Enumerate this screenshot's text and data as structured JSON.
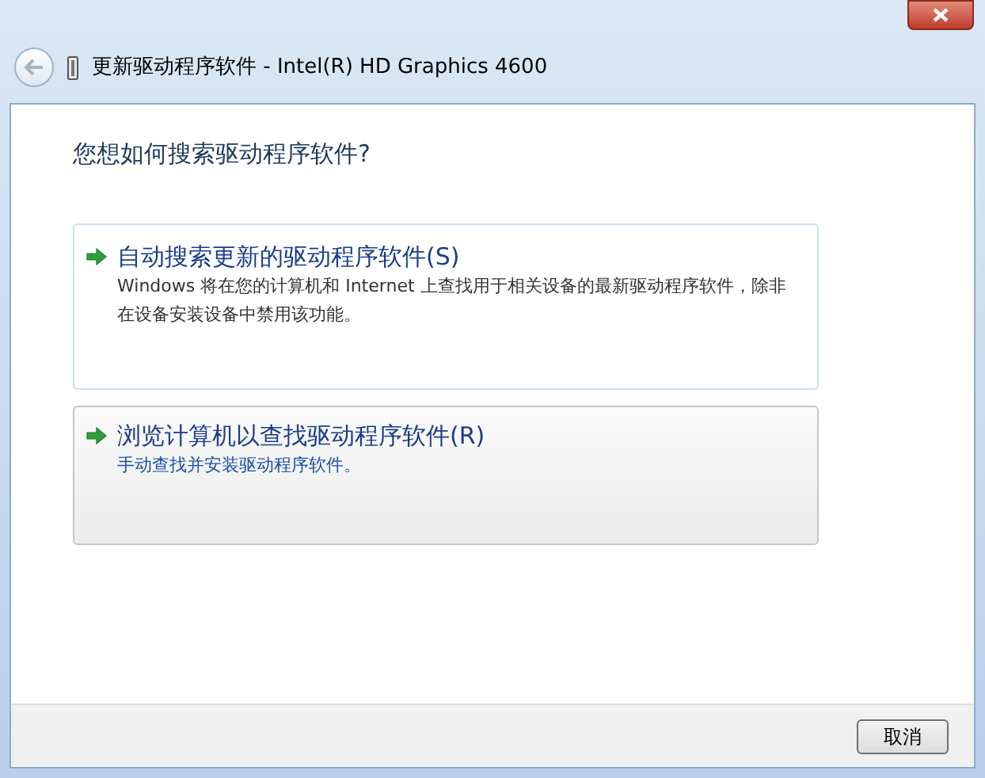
{
  "window": {
    "title": "更新驱动程序软件 - Intel(R) HD Graphics 4600"
  },
  "heading": "您想如何搜索驱动程序软件?",
  "options": [
    {
      "title": "自动搜索更新的驱动程序软件(S)",
      "description": "Windows 将在您的计算机和 Internet 上查找用于相关设备的最新驱动程序软件，除非在设备安装设备中禁用该功能。",
      "highlighted": false
    },
    {
      "title": "浏览计算机以查找驱动程序软件(R)",
      "description": "手动查找并安装驱动程序软件。",
      "highlighted": true
    }
  ],
  "buttons": [
    "取消"
  ]
}
